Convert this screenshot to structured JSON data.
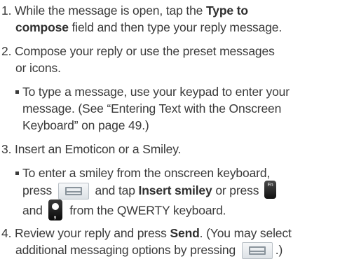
{
  "steps": [
    {
      "number": "1.",
      "text_a": "While the message is open, tap the",
      "bold_a": "Type to",
      "bold_b": "compose",
      "text_b": "field and then type your reply message."
    },
    {
      "number": "2.",
      "line1": "Compose your reply or use the preset messages",
      "line2": "or icons.",
      "bullet": {
        "line1": "To type a message, use your keypad to enter your",
        "line2": "message. (See “Entering Text with the Onscreen",
        "line3": "Keyboard” on page 49.)"
      }
    },
    {
      "number": "3.",
      "line1": "Insert an Emoticon or a Smiley.",
      "bullet": {
        "line1": "To enter a smiley from the onscreen keyboard,",
        "press": "press",
        "and_tap": "and tap",
        "insert_smiley": "Insert smiley",
        "or_press": "or press",
        "and": "and",
        "from_qwerty": "from the QWERTY keyboard."
      }
    },
    {
      "number": "4.",
      "text_a": "Review your reply and press",
      "send": "Send",
      "text_b": ". (You may select",
      "line2": "additional messaging options by pressing",
      "close": ".)"
    }
  ],
  "icons": {
    "menu_key": "menu-key-icon",
    "fn_key": "fn-key-icon",
    "fn_label": "Fn",
    "smiley_key": "smiley-key-icon"
  }
}
